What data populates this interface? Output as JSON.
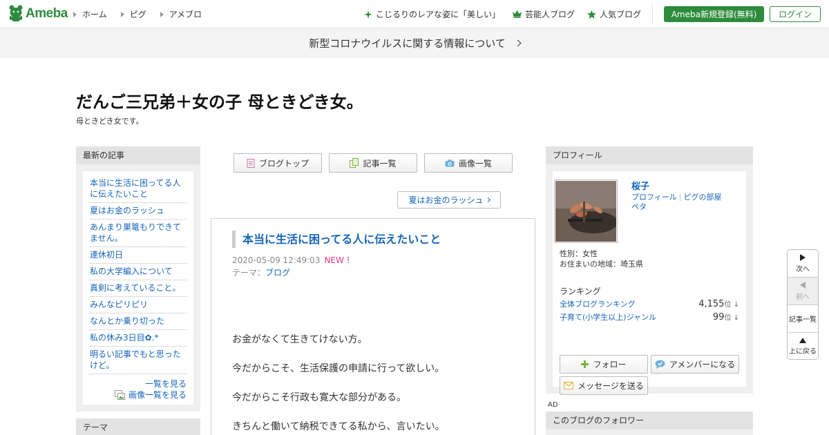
{
  "header": {
    "logo_text": "Ameba",
    "nav": [
      "ホーム",
      "ピグ",
      "アメブロ"
    ],
    "links": [
      {
        "icon": "sparkle-icon",
        "label": "こじるりのレアな姿に「美しい」"
      },
      {
        "icon": "crown-icon",
        "label": "芸能人ブログ"
      },
      {
        "icon": "star-icon",
        "label": "人気ブログ"
      }
    ],
    "register_label": "Ameba新規登録(無料)",
    "login_label": "ログイン",
    "brand_color": "#2d8c3c"
  },
  "notice": {
    "text": "新型コロナウイルスに関する情報について"
  },
  "blog": {
    "title": "だんご三兄弟＋女の子 母ときどき女。",
    "description": "母ときどき女です。"
  },
  "sidebar": {
    "latest_heading": "最新の記事",
    "articles": [
      "本当に生活に困ってる人に伝えたいこと",
      "夏はお金のラッシュ",
      "あんまり巣篭もりできてません。",
      "連休初日",
      "私の大学編入について",
      "真剣に考えていること。",
      "みんなピリピリ",
      "なんとか乗り切った",
      "私の休み3日目✿.*",
      "明るい記事でもと思ったけど。"
    ],
    "see_all": "一覧を見る",
    "see_images": "画像一覧を見る",
    "theme_heading": "テーマ"
  },
  "tabs": {
    "blog_top": "ブログトップ",
    "article_list": "記事一覧",
    "image_list": "画像一覧"
  },
  "next_post": "夏はお金のラッシュ",
  "article": {
    "title": "本当に生活に困ってる人に伝えたいこと",
    "date": "2020-05-09 12:49:03",
    "new_badge": "NEW !",
    "theme_label": "テーマ：",
    "theme_value": "ブログ",
    "body": [
      "お金がなくて生きてけない方。",
      "今だからこそ、生活保護の申請に行って欲しい。",
      "今だからこそ行政も寛大な部分がある。",
      "きちんと働いて納税できてる私から、言いたい。"
    ]
  },
  "profile": {
    "heading": "プロフィール",
    "name": "桜子",
    "link_profile": "プロフィール",
    "link_room": "ピグの部屋",
    "link_peta": "ペタ",
    "gender": "性別：女性",
    "residence": "お住まいの地域：埼玉県",
    "ranking_heading": "ランキング",
    "rankings": [
      {
        "label": "全体ブログランキング",
        "value": "4,155",
        "unit": "位 ↓"
      },
      {
        "label": "子育て(小学生以上)ジャンル",
        "value": "99",
        "unit": "位 ↓"
      }
    ],
    "follow": "フォロー",
    "amember": "アメンバーになる",
    "message": "メッセージを送る"
  },
  "ad_label": "AD",
  "followers_heading": "このブログのフォロワー",
  "float_nav": {
    "next": "次へ",
    "prev": "前へ",
    "list": "記事一覧",
    "top": "上に戻る"
  }
}
